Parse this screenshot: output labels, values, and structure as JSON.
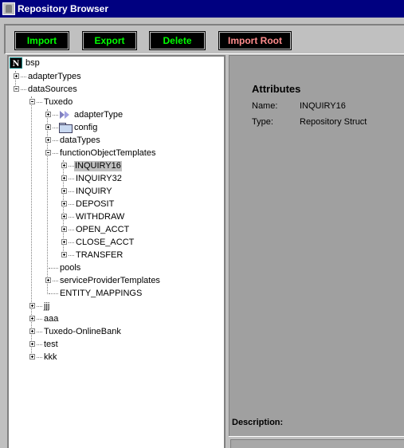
{
  "window": {
    "title": "Repository Browser"
  },
  "toolbar": {
    "import_label": "Import",
    "export_label": "Export",
    "delete_label": "Delete",
    "import_root_label": "Import Root"
  },
  "tree": {
    "root": "bsp",
    "nodes": {
      "adapterTypes": "adapterTypes",
      "dataSources": "dataSources",
      "tuxedo": "Tuxedo",
      "adapterType": "adapterType",
      "config": "config",
      "dataTypes": "dataTypes",
      "functionObjectTemplates": "functionObjectTemplates",
      "inquiry16": "INQUIRY16",
      "inquiry32": "INQUIRY32",
      "inquiry": "INQUIRY",
      "deposit": "DEPOSIT",
      "withdraw": "WITHDRAW",
      "open_acct": "OPEN_ACCT",
      "close_acct": "CLOSE_ACCT",
      "transfer": "TRANSFER",
      "pools": "pools",
      "serviceProviderTemplates": "serviceProviderTemplates",
      "entity_mappings": "ENTITY_MAPPINGS",
      "jjj": "jjj",
      "aaa": "aaa",
      "tuxedo_online_bank": "Tuxedo-OnlineBank",
      "test": "test",
      "kkk": "kkk"
    },
    "selected": "INQUIRY16"
  },
  "details": {
    "heading": "Attributes",
    "name_key": "Name:",
    "name_value": "INQUIRY16",
    "type_key": "Type:",
    "type_value": "Repository Struct",
    "description_label": "Description:"
  },
  "colors": {
    "titlebar": "#000080",
    "button_bg": "#000000",
    "button_text": "#00ff00",
    "import_root_text": "#ff8c8c",
    "detail_bg": "#a0a0a0"
  }
}
